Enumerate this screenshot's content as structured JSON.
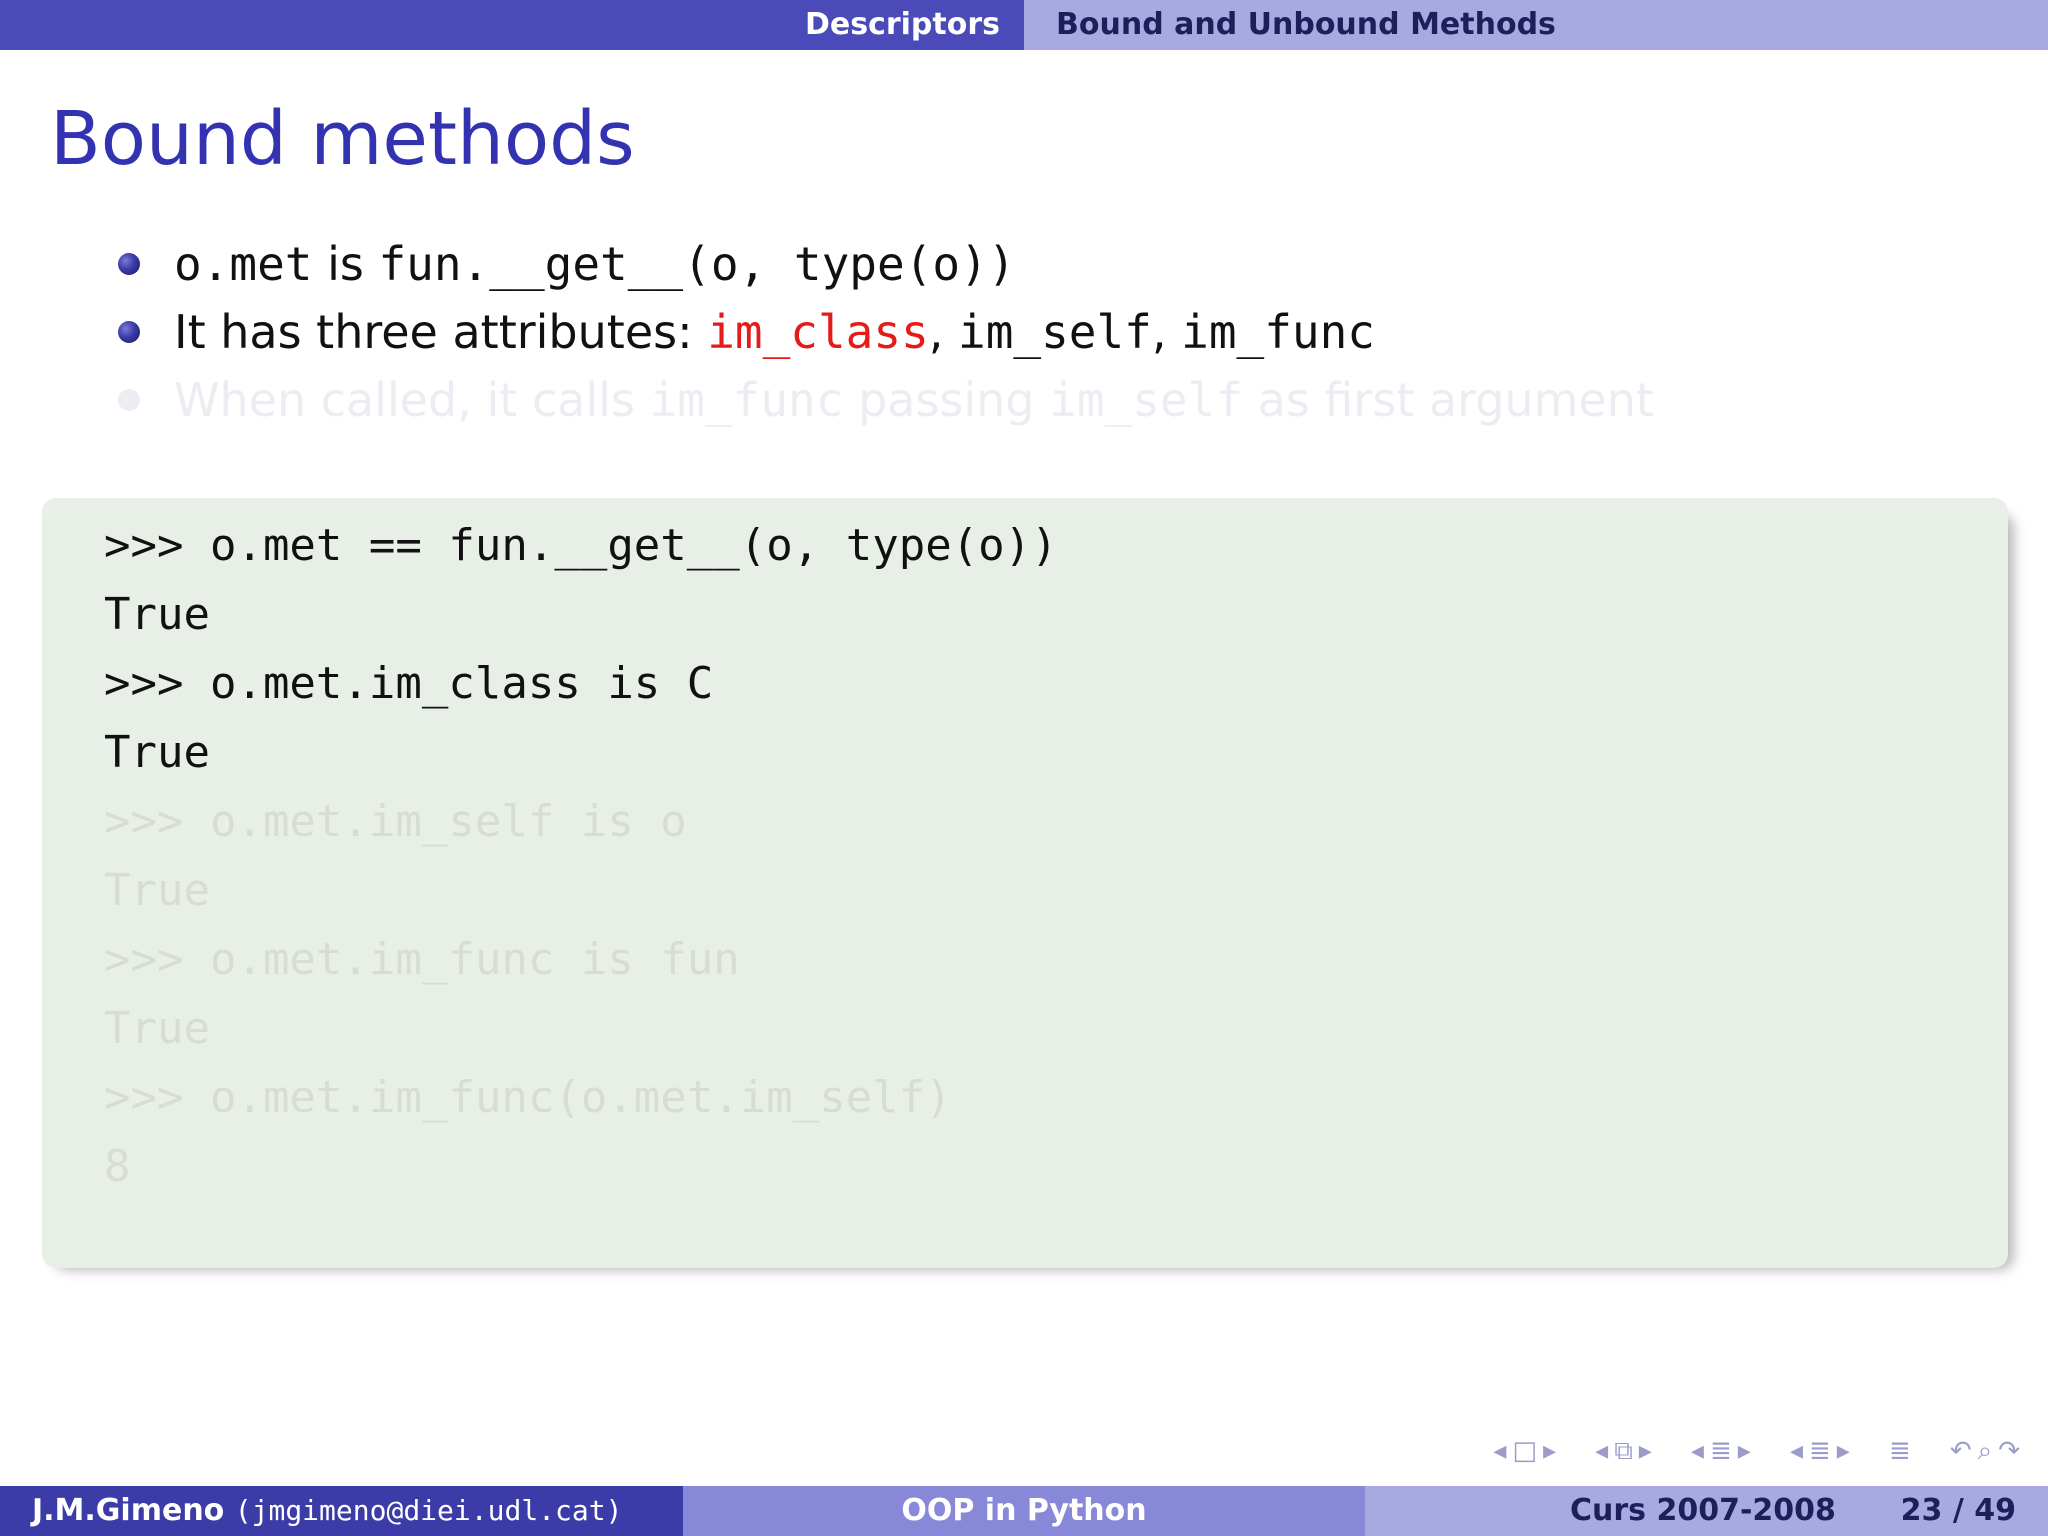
{
  "header": {
    "section": "Descriptors",
    "subsection": "Bound and Unbound Methods"
  },
  "frame": {
    "title": "Bound methods"
  },
  "bullets": [
    {
      "code1": "o.met",
      "text1": " is ",
      "code2": "fun.__get__(o, type(o))"
    },
    {
      "text1": "It has three attributes: ",
      "code_highlight": "im_class",
      "sep1": ", ",
      "code2": "im_self",
      "sep2": ", ",
      "code3": "im_func"
    },
    {
      "text1": "When called, it calls ",
      "code1": "im_func",
      "text2": " passing ",
      "code2": "im_self",
      "text3": " as first argument"
    }
  ],
  "code": {
    "lines": [
      ">>> o.met == fun.__get__(o, type(o))",
      "True",
      ">>> o.met.im_class is C",
      "True",
      ">>> o.met.im_self is o",
      "True",
      ">>> o.met.im_func is fun",
      "True",
      ">>> o.met.im_func(o.met.im_self)",
      "8"
    ]
  },
  "footer": {
    "author": "J.M.Gimeno",
    "email": "(jmgimeno@diei.udl.cat)",
    "title": "OOP in Python",
    "course": "Curs 2007-2008",
    "page": "23 / 49"
  },
  "colors": {
    "header_dark": "#4a4ab8",
    "header_light": "#a9a9e2",
    "title": "#3333b2",
    "highlight": "#e51a1a",
    "code_background": "#e8efe6"
  },
  "nav_icons": [
    "frame-prev-icon",
    "frame-icon",
    "frame-next-icon",
    "subsection-prev-icon",
    "subsection-icon",
    "subsection-next-icon",
    "section-prev-icon",
    "section-icon",
    "section-next-icon",
    "slide-prev-icon",
    "slide-icon",
    "slide-next-icon",
    "toc-icon",
    "back-icon",
    "search-icon",
    "forward-icon"
  ]
}
